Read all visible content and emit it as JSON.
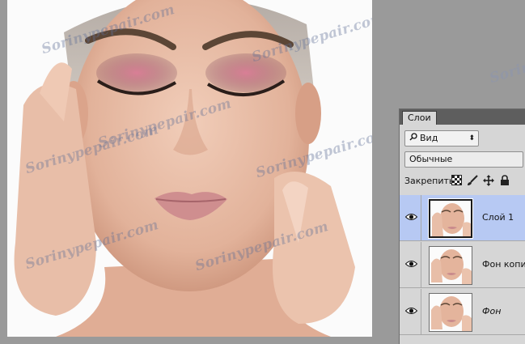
{
  "watermark": "Sorinypepair.com",
  "layers_panel": {
    "tab_label": "Слои",
    "filter_label": "Вид",
    "blend_mode": "Обычные",
    "lock_label": "Закрепить:",
    "lock_icons": [
      "lock-transparent-pixels-icon",
      "lock-image-pixels-icon",
      "lock-position-icon",
      "lock-all-icon"
    ],
    "layers": [
      {
        "name": "Слой 1",
        "visible": true,
        "selected": true,
        "italic": false
      },
      {
        "name": "Фон копия",
        "visible": true,
        "selected": false,
        "italic": false
      },
      {
        "name": "Фон",
        "visible": true,
        "selected": false,
        "italic": true
      }
    ]
  },
  "colors": {
    "workspace": "#9a9a9a",
    "panel_bg": "#d6d6d6",
    "selected_layer": "#b7c9f3",
    "skin": "#e6b9a2"
  }
}
